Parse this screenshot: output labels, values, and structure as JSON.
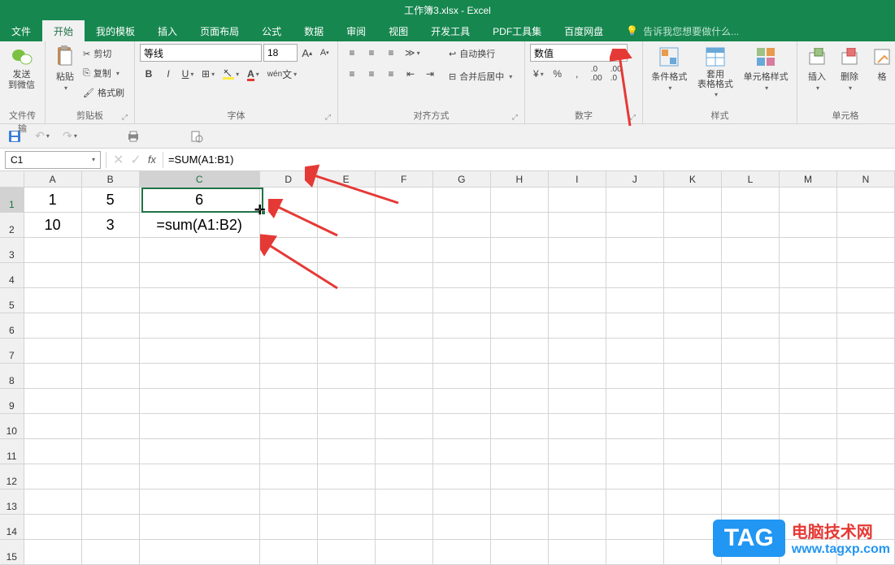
{
  "title": "工作簿3.xlsx - Excel",
  "tabs": [
    "文件",
    "开始",
    "我的模板",
    "插入",
    "页面布局",
    "公式",
    "数据",
    "审阅",
    "视图",
    "开发工具",
    "PDF工具集",
    "百度网盘"
  ],
  "active_tab": 1,
  "tellme": "告诉我您想要做什么...",
  "ribbon": {
    "group_wechat": "文件传输",
    "send_wechat": "发送\n到微信",
    "group_clip": "剪贴板",
    "paste": "粘贴",
    "cut": "剪切",
    "copy": "复制",
    "format_painter": "格式刷",
    "group_font": "字体",
    "font_name": "等线",
    "font_size": "18",
    "bold": "B",
    "italic": "I",
    "group_align": "对齐方式",
    "wrap": "自动换行",
    "merge": "合并后居中",
    "group_num": "数字",
    "num_format": "数值",
    "group_style": "样式",
    "cond_fmt": "条件格式",
    "table_fmt": "套用\n表格格式",
    "cell_style": "单元格样式",
    "group_cells": "单元格",
    "insert": "插入",
    "delete": "删除",
    "format": "格"
  },
  "namebox": "C1",
  "formula": "=SUM(A1:B1)",
  "columns": [
    "A",
    "B",
    "C",
    "D",
    "E",
    "F",
    "G",
    "H",
    "I",
    "J",
    "K",
    "L",
    "M",
    "N"
  ],
  "rownums": [
    "1",
    "2",
    "3",
    "4",
    "5",
    "6",
    "7",
    "8",
    "9",
    "10",
    "11",
    "12",
    "13",
    "14",
    "15"
  ],
  "cells": {
    "A1": "1",
    "B1": "5",
    "C1": "6",
    "A2": "10",
    "B2": "3",
    "C2": "=sum(A1:B2)"
  },
  "watermark": {
    "tag": "TAG",
    "line1": "电脑技术网",
    "line2": "www.tagxp.com"
  }
}
